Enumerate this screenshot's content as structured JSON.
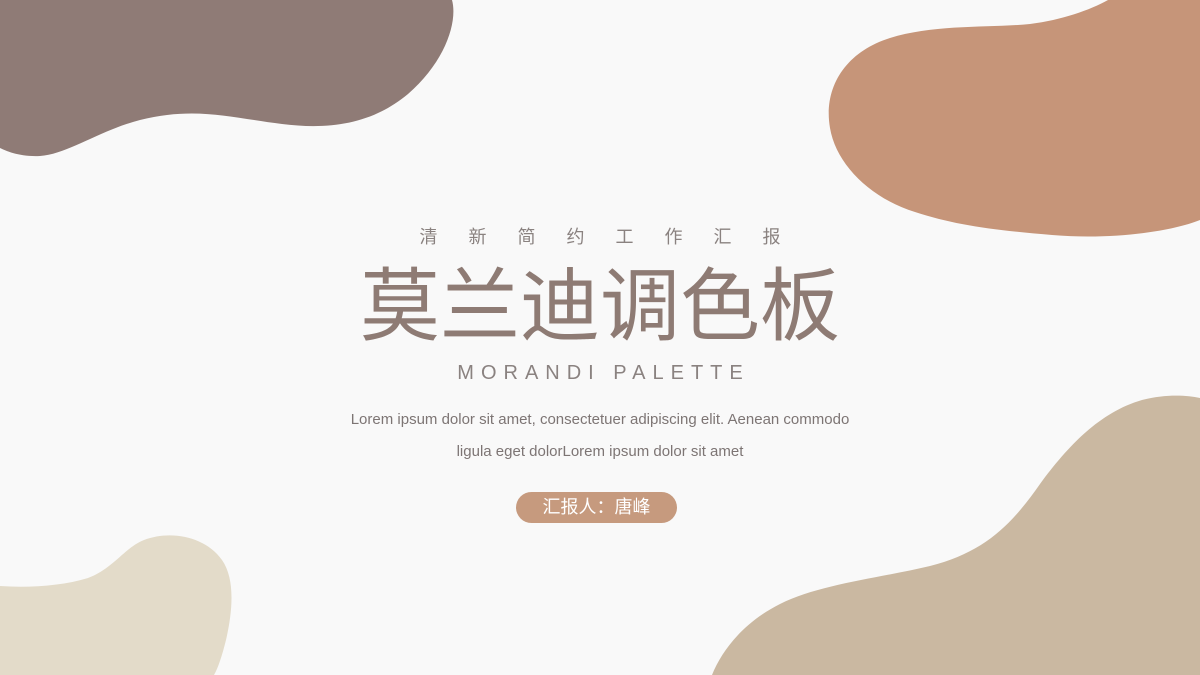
{
  "slide": {
    "subtitle": "清新简约工作汇报",
    "title": "莫兰迪调色板",
    "title_en": "MORANDI PALETTE",
    "description": [
      "Lorem ipsum dolor sit amet, consectetuer adipiscing elit. Aenean commodo",
      "ligula eget dolorLorem ipsum dolor sit amet"
    ],
    "reporter": "汇报人：唐峰"
  },
  "colors": {
    "background": "#f9f9f9",
    "blob_top_left": "#8f7b76",
    "blob_top_right": "#c69579",
    "blob_bottom_right": "#cab8a1",
    "blob_bottom_left": "#e3dbc9",
    "title": "#8e7b74",
    "reporter_badge": "#c69a7e"
  }
}
